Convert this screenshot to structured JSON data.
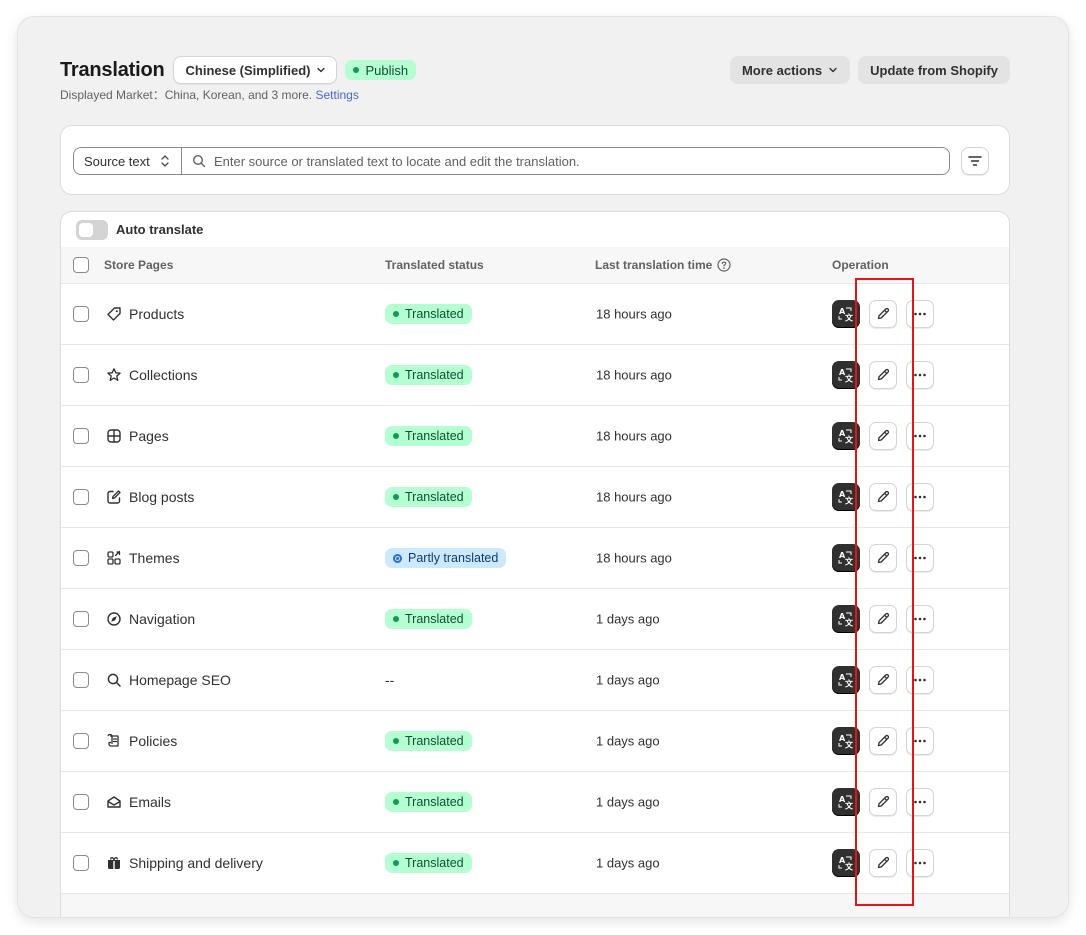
{
  "header": {
    "title": "Translation",
    "language": "Chinese (Simplified)",
    "publish_label": "Publish",
    "more_actions": "More actions",
    "update": "Update from Shopify",
    "market_prefix": "Displayed Market：China, Korean, and 3 more.",
    "settings_link": "Settings"
  },
  "search": {
    "source_label": "Source text",
    "placeholder": "Enter source or translated text to locate and edit the translation."
  },
  "table": {
    "auto_translate": "Auto translate",
    "columns": {
      "pages": "Store Pages",
      "status": "Translated status",
      "time": "Last translation time",
      "operation": "Operation"
    },
    "rows": [
      {
        "icon": "tag-icon",
        "name": "Products",
        "status": "Translated",
        "status_type": "ok",
        "time": "18 hours ago"
      },
      {
        "icon": "star-icon",
        "name": "Collections",
        "status": "Translated",
        "status_type": "ok",
        "time": "18 hours ago"
      },
      {
        "icon": "pages-icon",
        "name": "Pages",
        "status": "Translated",
        "status_type": "ok",
        "time": "18 hours ago"
      },
      {
        "icon": "edit-note-icon",
        "name": "Blog posts",
        "status": "Translated",
        "status_type": "ok",
        "time": "18 hours ago"
      },
      {
        "icon": "themes-icon",
        "name": "Themes",
        "status": "Partly translated",
        "status_type": "partial",
        "time": "18 hours ago"
      },
      {
        "icon": "compass-icon",
        "name": "Navigation",
        "status": "Translated",
        "status_type": "ok",
        "time": "1 days ago"
      },
      {
        "icon": "search-icon",
        "name": "Homepage SEO",
        "status": "--",
        "status_type": "none",
        "time": "1 days ago"
      },
      {
        "icon": "policy-icon",
        "name": "Policies",
        "status": "Translated",
        "status_type": "ok",
        "time": "1 days ago"
      },
      {
        "icon": "email-icon",
        "name": "Emails",
        "status": "Translated",
        "status_type": "ok",
        "time": "1 days ago"
      },
      {
        "icon": "gift-icon",
        "name": "Shipping and delivery",
        "status": "Translated",
        "status_type": "ok",
        "time": "1 days ago"
      }
    ]
  },
  "colors": {
    "badge_green": "#b4fed2",
    "badge_blue": "#cde9ff",
    "highlight_red": "#e5141b"
  }
}
